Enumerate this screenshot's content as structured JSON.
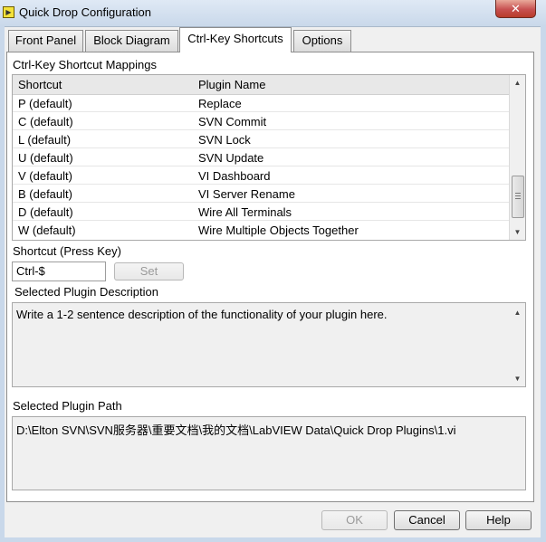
{
  "window": {
    "title": "Quick Drop Configuration",
    "close_glyph": "✕",
    "icon": "labview-vi-icon"
  },
  "tabs": [
    {
      "label": "Front Panel",
      "active": false
    },
    {
      "label": "Block Diagram",
      "active": false
    },
    {
      "label": "Ctrl-Key Shortcuts",
      "active": true
    },
    {
      "label": "Options",
      "active": false
    }
  ],
  "mappings": {
    "title": "Ctrl-Key Shortcut Mappings",
    "columns": [
      "Shortcut",
      "Plugin Name"
    ],
    "rows": [
      {
        "shortcut": "P (default)",
        "plugin": "Replace"
      },
      {
        "shortcut": "C (default)",
        "plugin": "SVN Commit"
      },
      {
        "shortcut": "L (default)",
        "plugin": "SVN Lock"
      },
      {
        "shortcut": "U (default)",
        "plugin": "SVN Update"
      },
      {
        "shortcut": "V (default)",
        "plugin": "VI Dashboard"
      },
      {
        "shortcut": "B (default)",
        "plugin": "VI Server Rename"
      },
      {
        "shortcut": "D (default)",
        "plugin": "Wire All Terminals"
      },
      {
        "shortcut": "W (default)",
        "plugin": "Wire Multiple Objects Together"
      }
    ]
  },
  "shortcut": {
    "label": "Shortcut (Press Key)",
    "value": "Ctrl-$",
    "set_label": "Set"
  },
  "description": {
    "label": "Selected Plugin Description",
    "text": "Write a 1-2 sentence description of the functionality of your plugin here."
  },
  "path": {
    "label": "Selected Plugin Path",
    "text": "D:\\Elton SVN\\SVN服务器\\重要文档\\我的文档\\LabVIEW Data\\Quick Drop Plugins\\1.vi"
  },
  "footer": {
    "ok_label": "OK",
    "cancel_label": "Cancel",
    "help_label": "Help"
  },
  "colors": {
    "titlebar": "#c9d8ea",
    "close_button": "#c75050",
    "panel": "#ffffff",
    "dialog_bg": "#f0f0f0"
  }
}
